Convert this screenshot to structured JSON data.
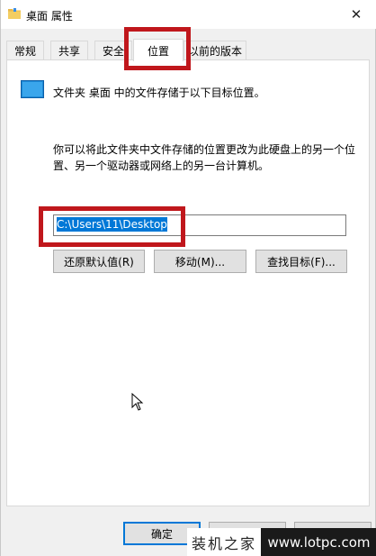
{
  "window": {
    "title": "桌面 属性",
    "close_glyph": "✕"
  },
  "tabs": [
    {
      "label": "常规",
      "active": false
    },
    {
      "label": "共享",
      "active": false
    },
    {
      "label": "安全",
      "active": false
    },
    {
      "label": "位置",
      "active": true
    },
    {
      "label": "以前的版本",
      "active": false
    }
  ],
  "location": {
    "info_text": "文件夹 桌面 中的文件存储于以下目标位置。",
    "description": "你可以将此文件夹中文件存储的位置更改为此硬盘上的另一个位置、另一个驱动器或网络上的另一台计算机。",
    "path_value": "C:\\Users\\11\\Desktop"
  },
  "buttons": {
    "restore_default": "还原默认值(R)",
    "move": "移动(M)...",
    "find_target": "查找目标(F)...",
    "ok": "确定"
  },
  "watermark": {
    "left_text": "装机之家",
    "right_text": "www.lotpc.com"
  },
  "colors": {
    "highlight_box": "#c0171c",
    "selection": "#0078d7"
  },
  "icons": {
    "title": "folder-icon",
    "location": "desktop-folder-icon",
    "close": "close-icon",
    "cursor": "mouse-cursor-icon"
  }
}
